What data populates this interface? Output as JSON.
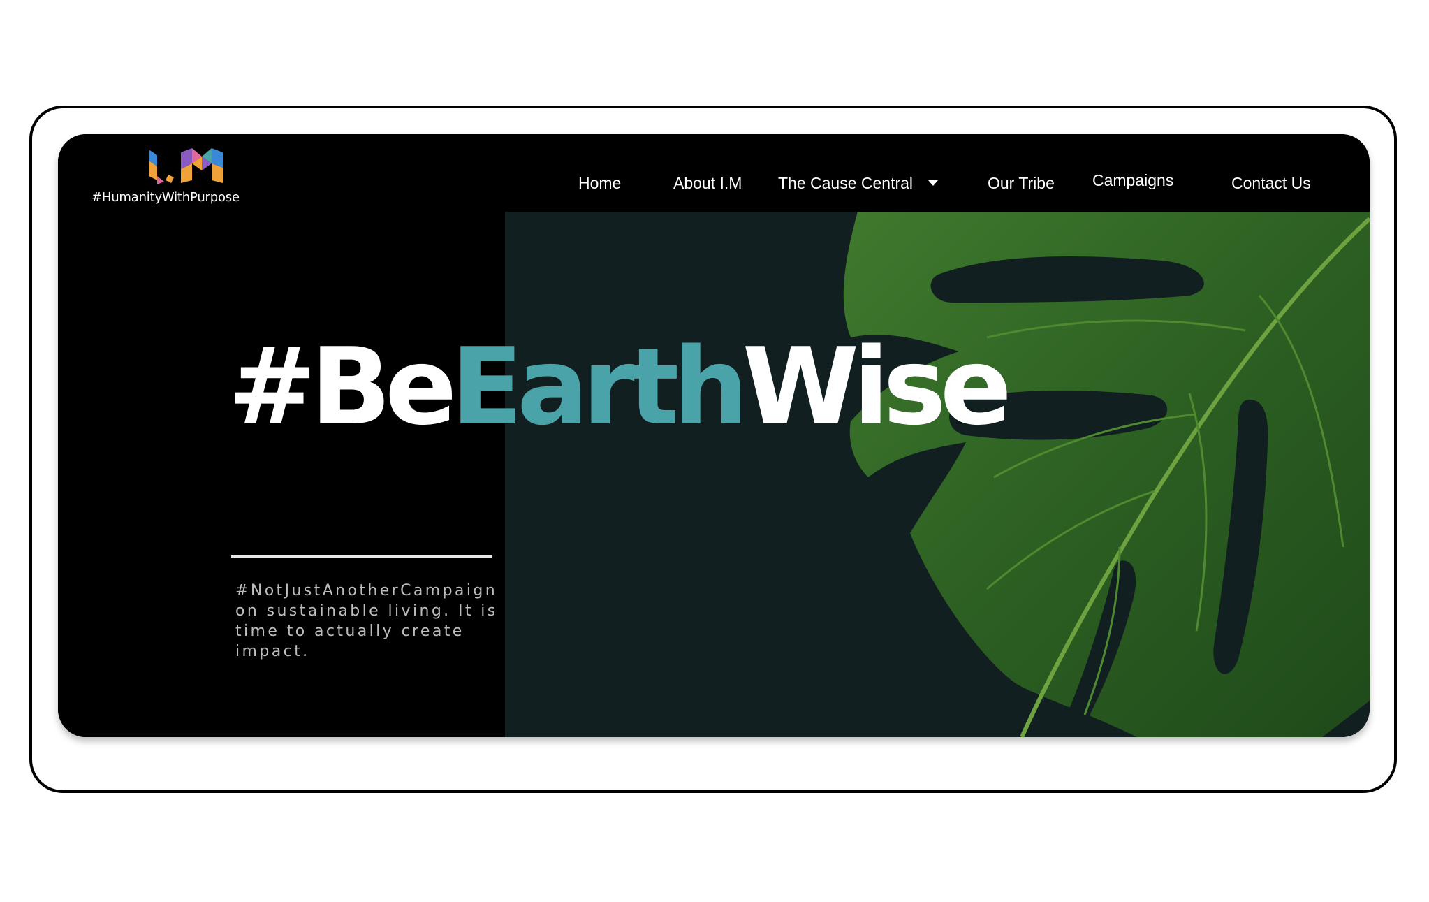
{
  "brand": {
    "tagline": "#HumanityWithPurpose",
    "logo_icon": "im-logo-icon",
    "colors": {
      "teal": "#4aa3a8",
      "orange": "#f0a23a",
      "purple": "#8a5cc2",
      "blue": "#3b88d6",
      "pink": "#e0679c"
    }
  },
  "nav": {
    "items": [
      {
        "label": "Home"
      },
      {
        "label": "About I.M"
      },
      {
        "label": "The Cause Central"
      },
      {
        "label": "Our Tribe"
      },
      {
        "label": "Campaigns"
      },
      {
        "label": "Contact Us"
      }
    ],
    "dropdown_icon": "caret-down-icon"
  },
  "hero": {
    "headline_part1": "#Be",
    "headline_part2": "Earth",
    "headline_part3": "Wise",
    "subtext": "#NotJustAnotherCampaign on sustainable living. It is time to actually create impact.",
    "image_icon": "monstera-leaf-icon",
    "colors": {
      "left_bg": "#000000",
      "right_bg": "#111f21",
      "accent": "#4aa3a8"
    }
  }
}
